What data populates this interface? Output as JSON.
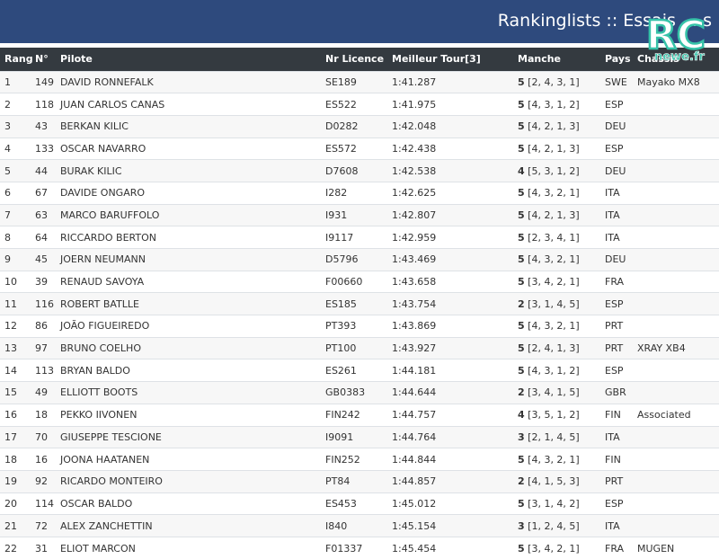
{
  "header": {
    "title": "Rankinglists :: Essais ... s"
  },
  "logo": {
    "text_main": "RC",
    "text_sub": "newe.fr",
    "color_main": "#ffffff",
    "color_accent": "#36c2a8"
  },
  "table": {
    "headers": [
      "Rang",
      "N°",
      "Pilote",
      "Nr Licence",
      "Meilleur Tour[3]",
      "Manche",
      "Pays",
      "Chassis"
    ],
    "rows": [
      {
        "rang": "1",
        "num": "149",
        "pilote": "DAVID RONNEFALK",
        "licence": "SE189",
        "tour": "1:41.287",
        "manche_n": "5",
        "manche_l": "[2, 4, 3, 1]",
        "pays": "SWE",
        "chassis": "Mayako MX8"
      },
      {
        "rang": "2",
        "num": "118",
        "pilote": "JUAN CARLOS CANAS",
        "licence": "ES522",
        "tour": "1:41.975",
        "manche_n": "5",
        "manche_l": "[4, 3, 1, 2]",
        "pays": "ESP",
        "chassis": ""
      },
      {
        "rang": "3",
        "num": "43",
        "pilote": "BERKAN KILIC",
        "licence": "D0282",
        "tour": "1:42.048",
        "manche_n": "5",
        "manche_l": "[4, 2, 1, 3]",
        "pays": "DEU",
        "chassis": ""
      },
      {
        "rang": "4",
        "num": "133",
        "pilote": "OSCAR NAVARRO",
        "licence": "ES572",
        "tour": "1:42.438",
        "manche_n": "5",
        "manche_l": "[4, 2, 1, 3]",
        "pays": "ESP",
        "chassis": ""
      },
      {
        "rang": "5",
        "num": "44",
        "pilote": "BURAK KILIC",
        "licence": "D7608",
        "tour": "1:42.538",
        "manche_n": "4",
        "manche_l": "[5, 3, 1, 2]",
        "pays": "DEU",
        "chassis": ""
      },
      {
        "rang": "6",
        "num": "67",
        "pilote": "DAVIDE ONGARO",
        "licence": "I282",
        "tour": "1:42.625",
        "manche_n": "5",
        "manche_l": "[4, 3, 2, 1]",
        "pays": "ITA",
        "chassis": ""
      },
      {
        "rang": "7",
        "num": "63",
        "pilote": "MARCO BARUFFOLO",
        "licence": "I931",
        "tour": "1:42.807",
        "manche_n": "5",
        "manche_l": "[4, 2, 1, 3]",
        "pays": "ITA",
        "chassis": ""
      },
      {
        "rang": "8",
        "num": "64",
        "pilote": "RICCARDO BERTON",
        "licence": "I9117",
        "tour": "1:42.959",
        "manche_n": "5",
        "manche_l": "[2, 3, 4, 1]",
        "pays": "ITA",
        "chassis": ""
      },
      {
        "rang": "9",
        "num": "45",
        "pilote": "JOERN NEUMANN",
        "licence": "D5796",
        "tour": "1:43.469",
        "manche_n": "5",
        "manche_l": "[4, 3, 2, 1]",
        "pays": "DEU",
        "chassis": ""
      },
      {
        "rang": "10",
        "num": "39",
        "pilote": "RENAUD SAVOYA",
        "licence": "F00660",
        "tour": "1:43.658",
        "manche_n": "5",
        "manche_l": "[3, 4, 2, 1]",
        "pays": "FRA",
        "chassis": ""
      },
      {
        "rang": "11",
        "num": "116",
        "pilote": "ROBERT BATLLE",
        "licence": "ES185",
        "tour": "1:43.754",
        "manche_n": "2",
        "manche_l": "[3, 1, 4, 5]",
        "pays": "ESP",
        "chassis": ""
      },
      {
        "rang": "12",
        "num": "86",
        "pilote": "JOÃO FIGUEIREDO",
        "licence": "PT393",
        "tour": "1:43.869",
        "manche_n": "5",
        "manche_l": "[4, 3, 2, 1]",
        "pays": "PRT",
        "chassis": ""
      },
      {
        "rang": "13",
        "num": "97",
        "pilote": "BRUNO COELHO",
        "licence": "PT100",
        "tour": "1:43.927",
        "manche_n": "5",
        "manche_l": "[2, 4, 1, 3]",
        "pays": "PRT",
        "chassis": "XRAY XB4"
      },
      {
        "rang": "14",
        "num": "113",
        "pilote": "BRYAN BALDO",
        "licence": "ES261",
        "tour": "1:44.181",
        "manche_n": "5",
        "manche_l": "[4, 3, 1, 2]",
        "pays": "ESP",
        "chassis": ""
      },
      {
        "rang": "15",
        "num": "49",
        "pilote": "ELLIOTT BOOTS",
        "licence": "GB0383",
        "tour": "1:44.644",
        "manche_n": "2",
        "manche_l": "[3, 4, 1, 5]",
        "pays": "GBR",
        "chassis": ""
      },
      {
        "rang": "16",
        "num": "18",
        "pilote": "PEKKO IIVONEN",
        "licence": "FIN242",
        "tour": "1:44.757",
        "manche_n": "4",
        "manche_l": "[3, 5, 1, 2]",
        "pays": "FIN",
        "chassis": "Associated"
      },
      {
        "rang": "17",
        "num": "70",
        "pilote": "GIUSEPPE TESCIONE",
        "licence": "I9091",
        "tour": "1:44.764",
        "manche_n": "3",
        "manche_l": "[2, 1, 4, 5]",
        "pays": "ITA",
        "chassis": ""
      },
      {
        "rang": "18",
        "num": "16",
        "pilote": "JOONA HAATANEN",
        "licence": "FIN252",
        "tour": "1:44.844",
        "manche_n": "5",
        "manche_l": "[4, 3, 2, 1]",
        "pays": "FIN",
        "chassis": ""
      },
      {
        "rang": "19",
        "num": "92",
        "pilote": "RICARDO MONTEIRO",
        "licence": "PT84",
        "tour": "1:44.857",
        "manche_n": "2",
        "manche_l": "[4, 1, 5, 3]",
        "pays": "PRT",
        "chassis": ""
      },
      {
        "rang": "20",
        "num": "114",
        "pilote": "OSCAR BALDO",
        "licence": "ES453",
        "tour": "1:45.012",
        "manche_n": "5",
        "manche_l": "[3, 1, 4, 2]",
        "pays": "ESP",
        "chassis": ""
      },
      {
        "rang": "21",
        "num": "72",
        "pilote": "ALEX ZANCHETTIN",
        "licence": "I840",
        "tour": "1:45.154",
        "manche_n": "3",
        "manche_l": "[1, 2, 4, 5]",
        "pays": "ITA",
        "chassis": ""
      },
      {
        "rang": "22",
        "num": "31",
        "pilote": "ELIOT MARCON",
        "licence": "F01337",
        "tour": "1:45.454",
        "manche_n": "5",
        "manche_l": "[3, 4, 2, 1]",
        "pays": "FRA",
        "chassis": "MUGEN"
      }
    ]
  }
}
